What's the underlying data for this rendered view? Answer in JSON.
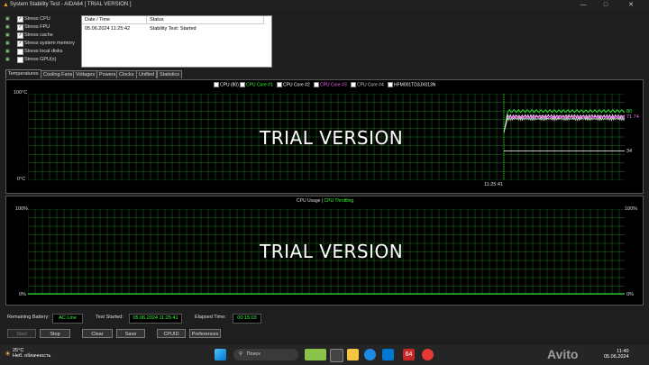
{
  "window": {
    "title": "System Stability Test - AIDA64  [ TRIAL VERSION ]"
  },
  "stress_options": [
    {
      "label": "Stress CPU",
      "checked": true,
      "icon": "cpu-icon"
    },
    {
      "label": "Stress FPU",
      "checked": true,
      "icon": "fpu-icon"
    },
    {
      "label": "Stress cache",
      "checked": true,
      "icon": "cache-icon"
    },
    {
      "label": "Stress system memory",
      "checked": true,
      "icon": "memory-icon"
    },
    {
      "label": "Stress local disks",
      "checked": false,
      "icon": "disk-icon"
    },
    {
      "label": "Stress GPU(s)",
      "checked": false,
      "icon": "gpu-icon"
    }
  ],
  "log": {
    "headers": [
      "Date / Time",
      "Status"
    ],
    "rows": [
      {
        "datetime": "05.06.2024 11:25:42",
        "status": "Stability Test: Started"
      }
    ]
  },
  "tabs": [
    "Temperatures",
    "Cooling Fans",
    "Voltages",
    "Powers",
    "Clocks",
    "Unified",
    "Statistics"
  ],
  "temp_chart": {
    "legend": [
      {
        "label": "CPU (80)",
        "color": "#ffffff"
      },
      {
        "label": "CPU Core #1",
        "color": "#3cff3c"
      },
      {
        "label": "CPU Core #2",
        "color": "#ffffff"
      },
      {
        "label": "CPU Core #3",
        "color": "#ff66ff"
      },
      {
        "label": "CPU Core #4",
        "color": "#cccccc"
      },
      {
        "label": "HFM001TD3JX013N",
        "color": "#ffffff"
      }
    ],
    "y_top": "100°C",
    "y_bottom": "0°C",
    "time_label": "11:25:41",
    "end_labels": [
      "80",
      "71 74",
      "34"
    ],
    "watermark": "TRIAL VERSION"
  },
  "usage_chart": {
    "legend_usage": "CPU Usage",
    "legend_sep": "|",
    "legend_throttle": "CPU Throttling",
    "y_top": "100%",
    "y_bottom": "0%",
    "watermark": "TRIAL VERSION"
  },
  "chart_data": [
    {
      "type": "line",
      "title": "",
      "ylim": [
        0,
        100
      ],
      "grid": true,
      "x": [
        "11:25:41"
      ],
      "series": [
        {
          "name": "CPU Core #1",
          "color": "#3cff3c",
          "start": 55,
          "end": 80
        },
        {
          "name": "CPU Core #2",
          "color": "#ffffff",
          "start": 55,
          "end": 74
        },
        {
          "name": "CPU Core #3",
          "color": "#ff66ff",
          "start": 55,
          "end": 73
        },
        {
          "name": "CPU Core #4",
          "color": "#cccccc",
          "start": 55,
          "end": 71
        },
        {
          "name": "HFM001TD3JX013N",
          "color": "#ffffff",
          "start": 34,
          "end": 34
        }
      ]
    },
    {
      "type": "line",
      "ylim": [
        0,
        100
      ],
      "grid": true,
      "series": [
        {
          "name": "CPU Usage",
          "color": "#3cff3c"
        },
        {
          "name": "CPU Throttling",
          "color": "#3cff3c"
        }
      ]
    }
  ],
  "status": {
    "battery_label": "Remaining Battery:",
    "battery_value": "AC Line",
    "started_label": "Test Started:",
    "started_value": "05.06.2024 11:25:41",
    "elapsed_label": "Elapsed Time:",
    "elapsed_value": "00:15:03"
  },
  "buttons": {
    "start": "Start",
    "stop": "Stop",
    "clear": "Clear",
    "save": "Save",
    "cpuid": "CPUID",
    "preferences": "Preferences"
  },
  "taskbar": {
    "temp": "25°C",
    "weather": "Неб. облачность",
    "search": "Поиск",
    "time": "11:40",
    "date": "05.06.2024",
    "watermark": "Avito"
  }
}
